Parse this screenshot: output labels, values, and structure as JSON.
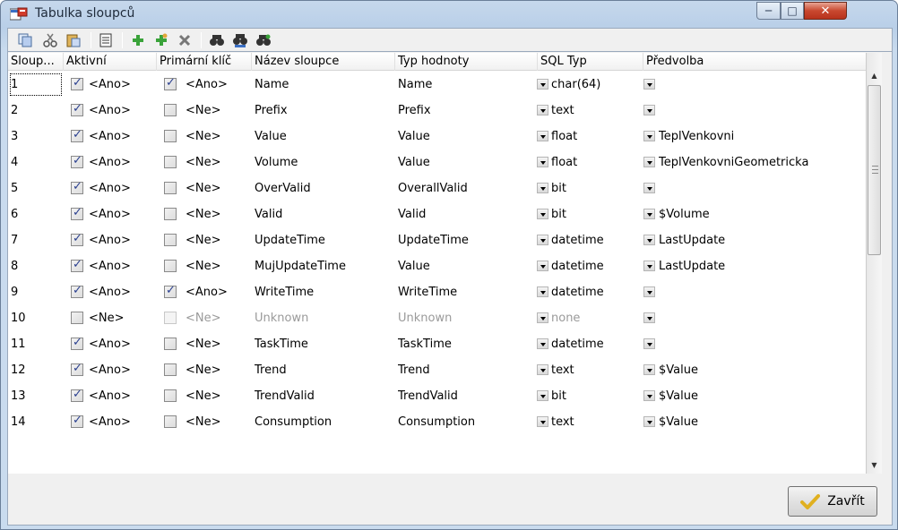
{
  "window": {
    "title": "Tabulka sloupců"
  },
  "toolbar": {
    "buttons": [
      "copy-icon",
      "cut-icon",
      "paste-icon",
      "table-properties-icon",
      "add-icon",
      "add-child-icon",
      "delete-icon",
      "find-icon",
      "find-replace-icon",
      "find-next-icon"
    ]
  },
  "columns": [
    "Sloup...",
    "Aktivní",
    "Primární klíč",
    "Název sloupce",
    "Typ hodnoty",
    "SQL Typ",
    "Předvolba"
  ],
  "rows": [
    {
      "n": "1",
      "active": true,
      "active_label": "<Ano>",
      "pk": true,
      "pk_label": "<Ano>",
      "name": "Name",
      "type": "Name",
      "sql": "char(64)",
      "pre": ""
    },
    {
      "n": "2",
      "active": true,
      "active_label": "<Ano>",
      "pk": false,
      "pk_label": "<Ne>",
      "name": "Prefix",
      "type": "Prefix",
      "sql": "text",
      "pre": ""
    },
    {
      "n": "3",
      "active": true,
      "active_label": "<Ano>",
      "pk": false,
      "pk_label": "<Ne>",
      "name": "Value",
      "type": "Value",
      "sql": "float",
      "pre": "TeplVenkovni"
    },
    {
      "n": "4",
      "active": true,
      "active_label": "<Ano>",
      "pk": false,
      "pk_label": "<Ne>",
      "name": "Volume",
      "type": "Value",
      "sql": "float",
      "pre": "TeplVenkovniGeometricka"
    },
    {
      "n": "5",
      "active": true,
      "active_label": "<Ano>",
      "pk": false,
      "pk_label": "<Ne>",
      "name": "OverValid",
      "type": "OverallValid",
      "sql": "bit",
      "pre": ""
    },
    {
      "n": "6",
      "active": true,
      "active_label": "<Ano>",
      "pk": false,
      "pk_label": "<Ne>",
      "name": "Valid",
      "type": "Valid",
      "sql": "bit",
      "pre": "$Volume"
    },
    {
      "n": "7",
      "active": true,
      "active_label": "<Ano>",
      "pk": false,
      "pk_label": "<Ne>",
      "name": "UpdateTime",
      "type": "UpdateTime",
      "sql": "datetime",
      "pre": "LastUpdate"
    },
    {
      "n": "8",
      "active": true,
      "active_label": "<Ano>",
      "pk": false,
      "pk_label": "<Ne>",
      "name": "MujUpdateTime",
      "type": "Value",
      "sql": "datetime",
      "pre": "LastUpdate"
    },
    {
      "n": "9",
      "active": true,
      "active_label": "<Ano>",
      "pk": true,
      "pk_label": "<Ano>",
      "name": "WriteTime",
      "type": "WriteTime",
      "sql": "datetime",
      "pre": ""
    },
    {
      "n": "10",
      "active": false,
      "active_label": "<Ne>",
      "pk": false,
      "pk_label": "<Ne>",
      "name": "Unknown",
      "type": "Unknown",
      "sql": "none",
      "pre": "",
      "disabled": true
    },
    {
      "n": "11",
      "active": true,
      "active_label": "<Ano>",
      "pk": false,
      "pk_label": "<Ne>",
      "name": "TaskTime",
      "type": "TaskTime",
      "sql": "datetime",
      "pre": ""
    },
    {
      "n": "12",
      "active": true,
      "active_label": "<Ano>",
      "pk": false,
      "pk_label": "<Ne>",
      "name": "Trend",
      "type": "Trend",
      "sql": "text",
      "pre": "$Value"
    },
    {
      "n": "13",
      "active": true,
      "active_label": "<Ano>",
      "pk": false,
      "pk_label": "<Ne>",
      "name": "TrendValid",
      "type": "TrendValid",
      "sql": "bit",
      "pre": "$Value"
    },
    {
      "n": "14",
      "active": true,
      "active_label": "<Ano>",
      "pk": false,
      "pk_label": "<Ne>",
      "name": "Consumption",
      "type": "Consumption",
      "sql": "text",
      "pre": "$Value"
    }
  ],
  "footer": {
    "close_label": "Zavřít"
  }
}
